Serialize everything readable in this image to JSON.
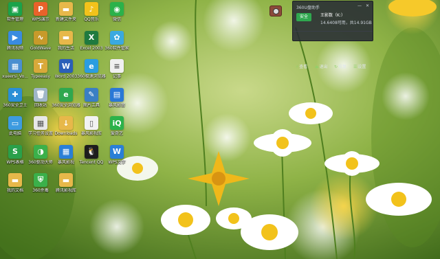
{
  "desktop_icons": [
    {
      "label": "软件管理",
      "icon": "software-manager-icon",
      "color": "#1aa34a",
      "glyph": "▣"
    },
    {
      "label": "WPS演示",
      "icon": "wps-presentation-icon",
      "color": "#e9622a",
      "glyph": "P"
    },
    {
      "label": "新建文件夹",
      "icon": "folder-icon",
      "color": "#e7b84a",
      "glyph": "▬"
    },
    {
      "label": "QQ音乐",
      "icon": "qq-music-icon",
      "color": "#f2c21b",
      "glyph": "♪"
    },
    {
      "label": "微信",
      "icon": "wechat-icon",
      "color": "#2bb24a",
      "glyph": "◉"
    },
    {
      "label": "腾讯视频",
      "icon": "tencent-video-icon",
      "color": "#3a8be0",
      "glyph": "▶"
    },
    {
      "label": "GoldWave",
      "icon": "goldwave-icon",
      "color": "#c79a2a",
      "glyph": "∿"
    },
    {
      "label": "我的生活",
      "icon": "folder-icon",
      "color": "#e7b84a",
      "glyph": "▬"
    },
    {
      "label": "Excel 2003",
      "icon": "excel-icon",
      "color": "#1f7a3f",
      "glyph": "X"
    },
    {
      "label": "360软件管家",
      "icon": "360-software-icon",
      "color": "#3aa9e0",
      "glyph": "✿"
    },
    {
      "label": "xueersi_Vo...",
      "icon": "xueersi-icon",
      "color": "#4a8fd0",
      "glyph": "▦"
    },
    {
      "label": "Typeeasy",
      "icon": "typeeasy-icon",
      "color": "#d9a93a",
      "glyph": "T"
    },
    {
      "label": "Word 2003",
      "icon": "word-icon",
      "color": "#2b5fb8",
      "glyph": "W"
    },
    {
      "label": "360极速浏览器",
      "icon": "360-browser-icon",
      "color": "#2a9de0",
      "glyph": "e"
    },
    {
      "label": "记事",
      "icon": "notepad-icon",
      "color": "#f0f0f0",
      "glyph": "≡"
    },
    {
      "label": "360安全卫士",
      "icon": "360-safe-icon",
      "color": "#2a8fd6",
      "glyph": "✚"
    },
    {
      "label": "回收站",
      "icon": "recycle-bin-icon",
      "color": "#9fb6c8",
      "glyph": "🗑"
    },
    {
      "label": "360安全浏览器",
      "icon": "360-safe-browser-icon",
      "color": "#2fa84f",
      "glyph": "e"
    },
    {
      "label": "图片工具",
      "icon": "image-tool-icon",
      "color": "#3a7fc4",
      "glyph": "✎"
    },
    {
      "label": "暴风影音",
      "icon": "baofeng-icon",
      "color": "#2a78d6",
      "glyph": "▤"
    },
    {
      "label": "此电脑",
      "icon": "this-pc-icon",
      "color": "#3d9be0",
      "glyph": "▭"
    },
    {
      "label": "学习任务设置",
      "icon": "calculator-icon",
      "color": "#e8e8e8",
      "glyph": "▦"
    },
    {
      "label": "Downloads",
      "icon": "downloads-folder-icon",
      "color": "#e7b84a",
      "glyph": "↓"
    },
    {
      "label": "暴风影视库",
      "icon": "document-icon",
      "color": "#f2f2f2",
      "glyph": "▯"
    },
    {
      "label": "爱奇艺",
      "icon": "iqiyi-icon",
      "color": "#2bb24a",
      "glyph": "iQ"
    },
    {
      "label": "WPS表格",
      "icon": "wps-sheet-icon",
      "color": "#2aa04a",
      "glyph": "S"
    },
    {
      "label": "360驱动大师",
      "icon": "360-driver-icon",
      "color": "#3bb04a",
      "glyph": "◑"
    },
    {
      "label": "暴风影视",
      "icon": "baofeng-video-icon",
      "color": "#2a7fd6",
      "glyph": "▦"
    },
    {
      "label": "Tencent QQ",
      "icon": "qq-icon",
      "color": "#1d1d1d",
      "glyph": "🐧"
    },
    {
      "label": "WPS文字",
      "icon": "wps-writer-icon",
      "color": "#2a7fd6",
      "glyph": "W"
    },
    {
      "label": "我的文档",
      "icon": "folder-icon",
      "color": "#e7b84a",
      "glyph": "▬"
    },
    {
      "label": "360杀毒",
      "icon": "360-antivirus-icon",
      "color": "#3bb04a",
      "glyph": "⛨"
    },
    {
      "label": "腾讯影视库",
      "icon": "tencent-library-icon",
      "color": "#e7b84a",
      "glyph": "▬"
    }
  ],
  "usb_widget": {
    "title": "360U盘助手",
    "status_badge": "安全",
    "device_name": "王影数（K:）",
    "capacity": "14.6408可用，共14.91GB",
    "actions": [
      {
        "label": "查看",
        "icon": "view-icon",
        "glyph": "⚡"
      },
      {
        "label": "退出",
        "icon": "eject-icon",
        "glyph": "⏏"
      },
      {
        "label": "恢复",
        "icon": "restore-icon",
        "glyph": "↻"
      },
      {
        "label": "设置",
        "icon": "settings-icon",
        "glyph": "☰"
      }
    ],
    "controls": [
      {
        "name": "minimize",
        "glyph": "—"
      },
      {
        "name": "close",
        "glyph": "✕"
      }
    ]
  }
}
